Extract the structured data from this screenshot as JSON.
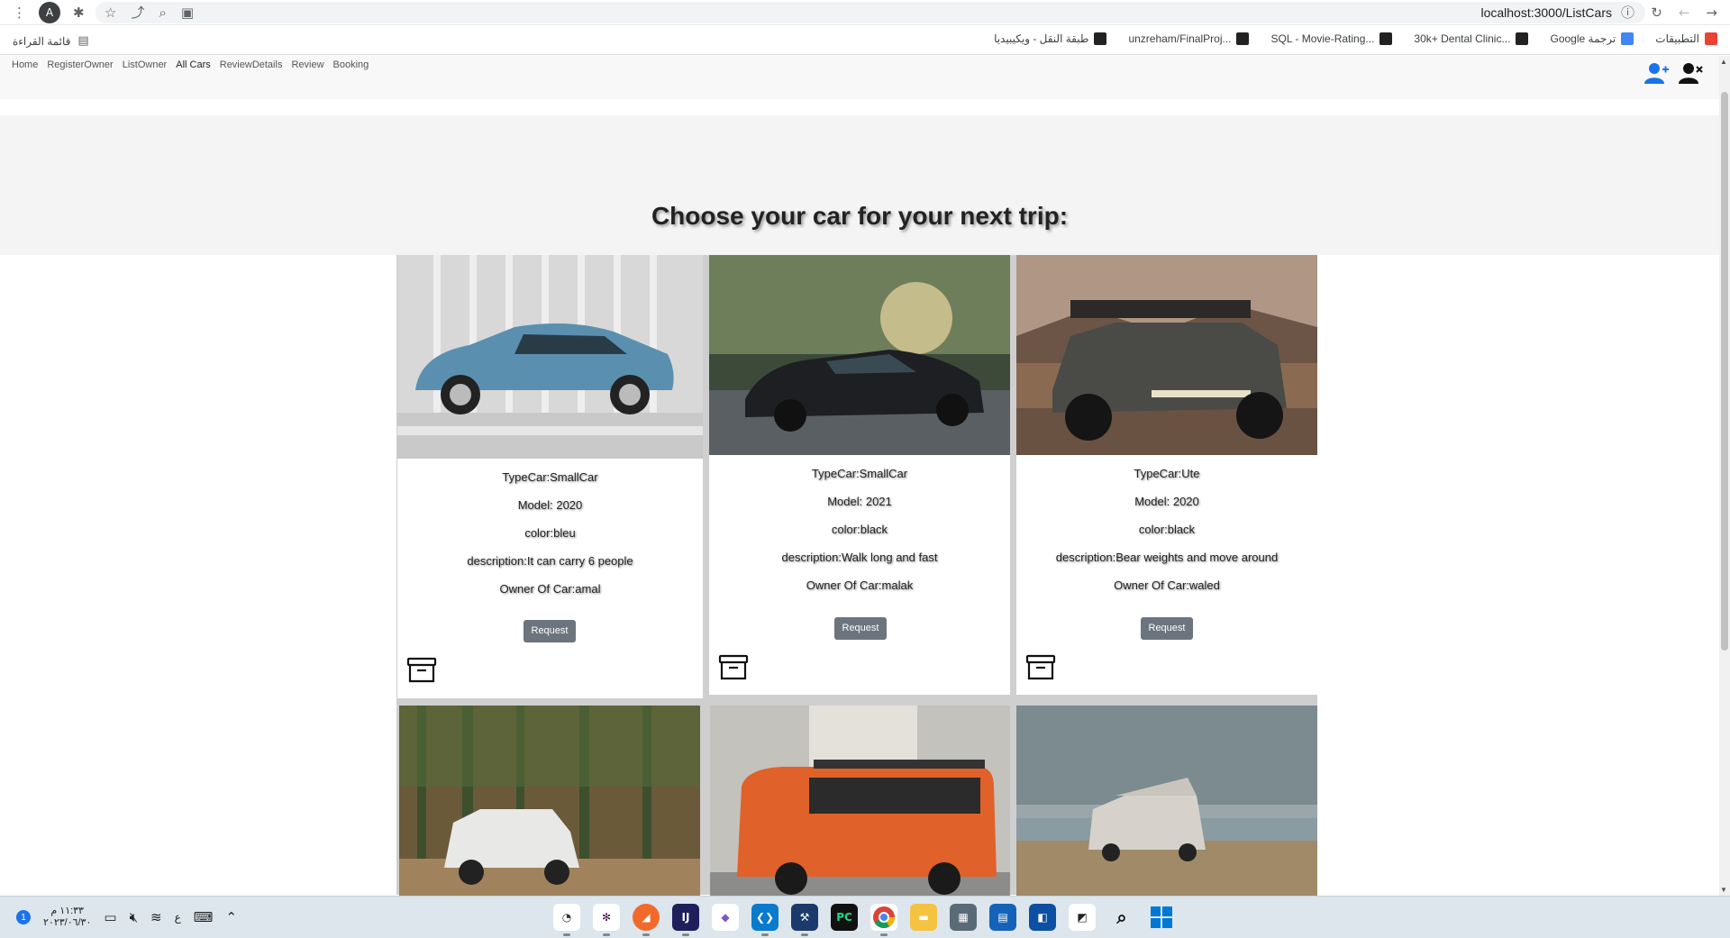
{
  "browser": {
    "avatar_letter": "A",
    "url": "localhost:3000/ListCars",
    "reading_list": "قائمة القراءة",
    "bookmarks": [
      {
        "label": "التطبيقات",
        "icon": "apps-grid-icon",
        "color": "#ea4335"
      },
      {
        "label": "Google ترجمة",
        "icon": "google-translate-icon",
        "color": "#4285f4"
      },
      {
        "label": "30k+ Dental Clinic...",
        "icon": "bookmark-dark-icon",
        "color": "#222222"
      },
      {
        "label": "SQL - Movie-Rating...",
        "icon": "github-icon",
        "color": "#222222"
      },
      {
        "label": "unzreham/FinalProj...",
        "icon": "github-icon",
        "color": "#222222"
      },
      {
        "label": "طبقة النقل - ويكيبيديا",
        "icon": "wikipedia-icon",
        "color": "#222222"
      }
    ]
  },
  "nav": {
    "links": [
      "Home",
      "RegisterOwner",
      "ListOwner",
      "All Cars",
      "ReviewDetails",
      "Review",
      "Booking"
    ],
    "active": "All Cars"
  },
  "hero": {
    "title": "Choose your car for your next trip:"
  },
  "cars": [
    {
      "type": "TypeCar:SmallCar",
      "model": "Model: 2020",
      "color": "color:bleu",
      "description": "description:It can carry 6 people",
      "owner": "Owner Of Car:amal",
      "request_label": "Request"
    },
    {
      "type": "TypeCar:SmallCar",
      "model": "Model: 2021",
      "color": "color:black",
      "description": "description:Walk long and fast",
      "owner": "Owner Of Car:malak",
      "request_label": "Request"
    },
    {
      "type": "TypeCar:Ute",
      "model": "Model: 2020",
      "color": "color:black",
      "description": "description:Bear weights and move around",
      "owner": "Owner Of Car:waled",
      "request_label": "Request"
    }
  ],
  "taskbar": {
    "time": "١١:٣٣ م",
    "date": "٢٠٢٣/٠٦/٣٠",
    "lang": "ع"
  }
}
